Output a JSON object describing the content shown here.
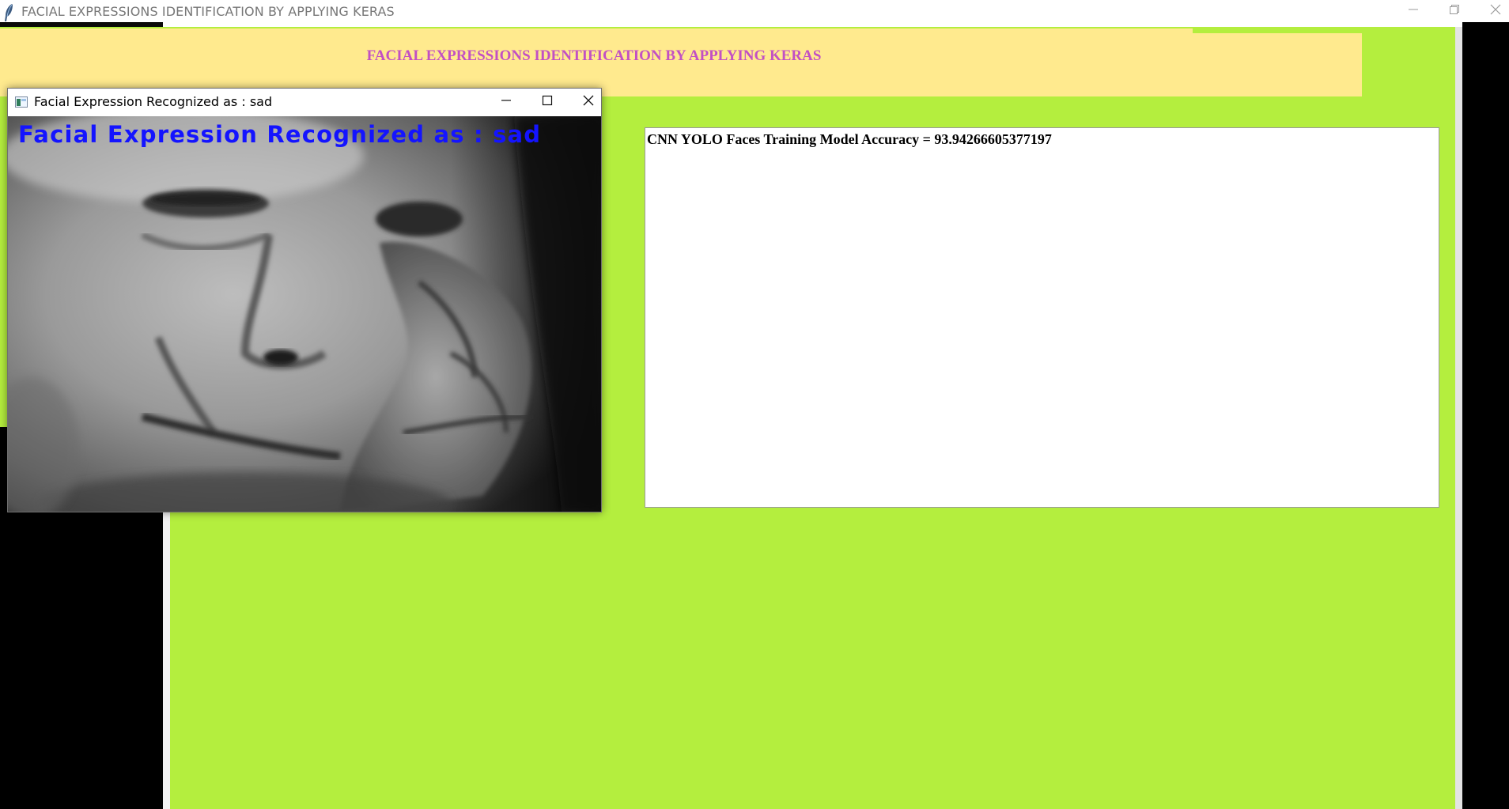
{
  "main_window": {
    "title": "FACIAL EXPRESSIONS IDENTIFICATION BY APPLYING KERAS",
    "icon": "feather-icon",
    "controls": {
      "minimize_icon": "minimize-icon",
      "restore_icon": "restore-icon",
      "close_icon": "close-icon"
    }
  },
  "header": {
    "title": "FACIAL EXPRESSIONS IDENTIFICATION BY APPLYING KERAS"
  },
  "output_panel": {
    "text": "CNN YOLO Faces Training Model Accuracy = 93.94266605377197"
  },
  "popup": {
    "title": "Facial Expression Recognized as : sad",
    "icon": "app-window-icon",
    "overlay_text": "Facial Expression Recognized as : sad",
    "controls": {
      "minimize_icon": "minimize-icon",
      "maximize_icon": "maximize-icon",
      "close_icon": "close-icon"
    }
  },
  "colors": {
    "canvas_bg": "#b4ee3e",
    "header_bg": "#ffea8e",
    "header_text": "#c250c4",
    "overlay_text": "#1414ff"
  }
}
